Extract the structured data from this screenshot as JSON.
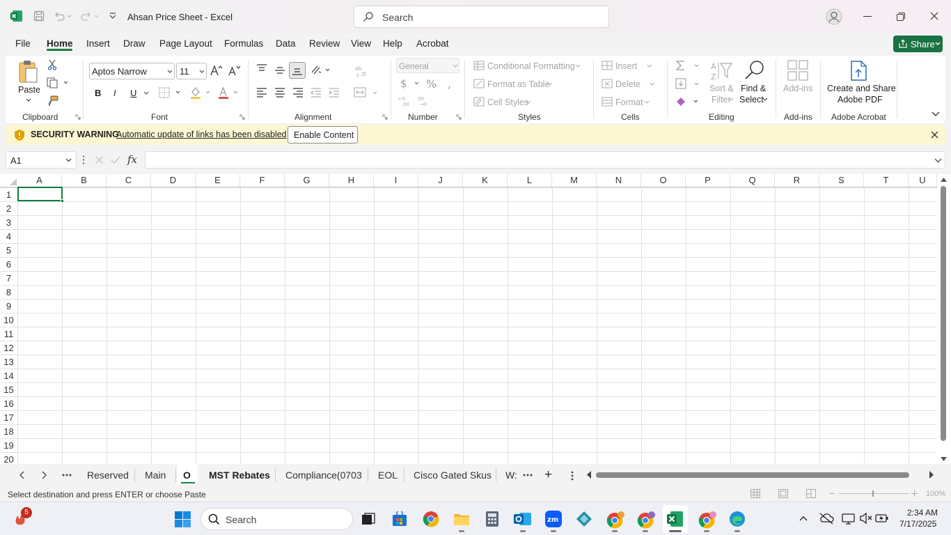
{
  "titlebar": {
    "doc_title": "Ahsan Price Sheet  -  Excel",
    "search_placeholder": "Search"
  },
  "menu": {
    "tabs": [
      "File",
      "Home",
      "Insert",
      "Draw",
      "Page Layout",
      "Formulas",
      "Data",
      "Review",
      "View",
      "Help",
      "Acrobat"
    ],
    "active": "Home",
    "share_label": "Share"
  },
  "ribbon": {
    "clipboard": {
      "label": "Clipboard",
      "paste": "Paste"
    },
    "font": {
      "label": "Font",
      "font_name": "Aptos Narrow",
      "font_size": "11",
      "bold": "B",
      "italic": "I",
      "underline": "U"
    },
    "alignment": {
      "label": "Alignment"
    },
    "number": {
      "label": "Number",
      "format": "General"
    },
    "styles": {
      "label": "Styles",
      "conditional": "Conditional Formatting",
      "format_table": "Format as Table",
      "cell_styles": "Cell Styles"
    },
    "cells": {
      "label": "Cells",
      "insert": "Insert",
      "delete": "Delete",
      "format": "Format"
    },
    "editing": {
      "label": "Editing",
      "sort": "Sort &",
      "filter": "Filter",
      "find": "Find &",
      "select": "Select"
    },
    "addins": {
      "label": "Add-ins",
      "button": "Add-ins"
    },
    "acrobat": {
      "label": "Adobe Acrobat",
      "line1": "Create and Share",
      "line2": "Adobe PDF"
    }
  },
  "security": {
    "title": "SECURITY WARNING",
    "message": "Automatic update of links has been disabled",
    "button": "Enable Content"
  },
  "formula": {
    "namebox": "A1",
    "fx": "fx",
    "value": ""
  },
  "grid": {
    "columns": [
      "A",
      "B",
      "C",
      "D",
      "E",
      "F",
      "G",
      "H",
      "I",
      "J",
      "K",
      "L",
      "M",
      "N",
      "O",
      "P",
      "Q",
      "R",
      "S",
      "T",
      "U"
    ],
    "rows": [
      "1",
      "2",
      "3",
      "4",
      "5",
      "6",
      "7",
      "8",
      "9",
      "10",
      "11",
      "12",
      "13",
      "14",
      "15",
      "16",
      "17",
      "18",
      "19",
      "20"
    ]
  },
  "sheets": {
    "tabs": [
      "Reserved",
      "Main",
      "O",
      "MST Rebates",
      "Compliance(0703",
      "EOL",
      "Cisco Gated Skus",
      "W:"
    ],
    "active": "O",
    "add": "+"
  },
  "status": {
    "message": "Select destination and press ENTER or choose Paste",
    "zoom": "100%"
  },
  "taskbar": {
    "search": "Search",
    "time": "2:34 AM",
    "date": "7/17/2025",
    "badge": "5"
  }
}
